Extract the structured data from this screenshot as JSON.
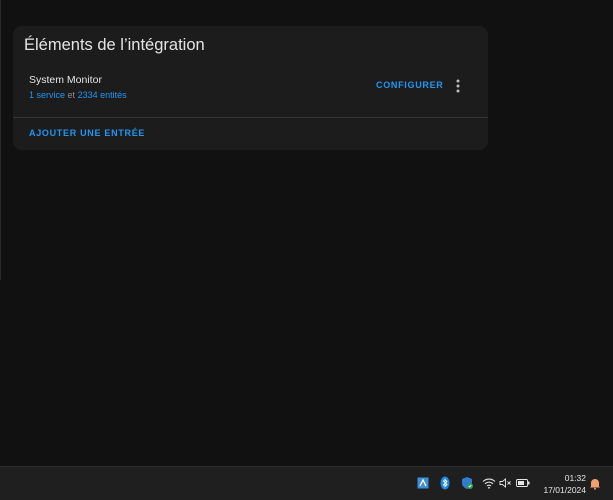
{
  "card": {
    "title": "Éléments de l’intégration",
    "entry": {
      "name": "System Monitor",
      "services_link": "1 service",
      "conjunction": "et",
      "entities_link": "2334 entités"
    },
    "configure_label": "CONFIGURER",
    "add_entry_label": "AJOUTER UNE ENTRÉE"
  },
  "taskbar": {
    "time": "01:32",
    "date": "17/01/2024",
    "tray_icons": [
      "remote-desktop-icon",
      "bluetooth-icon",
      "windows-security-icon",
      "wifi-icon",
      "volume-muted-icon",
      "battery-icon",
      "notifications-bell-icon"
    ]
  },
  "colors": {
    "accent": "#2196f3",
    "background": "#111111",
    "card": "#1c1c1c"
  }
}
